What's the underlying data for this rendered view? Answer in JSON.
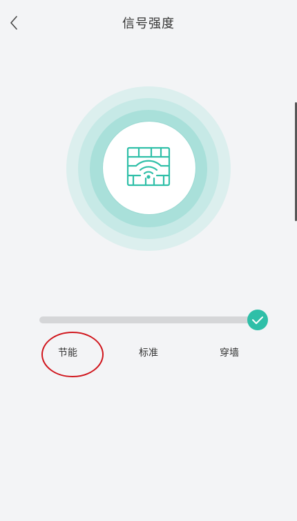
{
  "header": {
    "title": "信号强度",
    "back_icon": "chevron-left-icon"
  },
  "signal": {
    "icon": "wifi-firewall-icon",
    "accent_color": "#2fbfa8",
    "ring_colors": [
      "#dcefee",
      "#c6e9e6",
      "#a9e0da"
    ],
    "current_level_index": 2,
    "level_fraction": 1.0
  },
  "options": [
    {
      "label": "节能"
    },
    {
      "label": "标准"
    },
    {
      "label": "穿墙"
    }
  ],
  "annotation": {
    "shape": "ellipse",
    "color": "#d0151c",
    "target": "节能"
  }
}
